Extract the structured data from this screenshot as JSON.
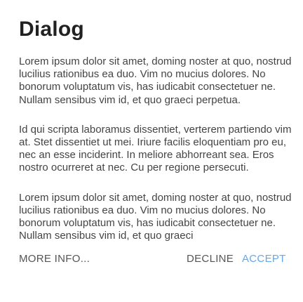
{
  "dialog": {
    "title": "Dialog",
    "paragraphs": [
      "Lorem ipsum dolor sit amet, doming noster at quo, nostrud lucilius rationibus ea duo. Vim no mucius dolores. No bonorum voluptatum vis, has iudicabit consectetuer ne. Nullam sensibus vim id, et quo graeci perpetua.",
      "Id qui scripta laboramus dissentiet, verterem partiendo vim at. Stet dissentiet ut mei. Iriure facilis eloquentiam pro eu, nec an esse inciderint. In meliore abhorreant sea. Eros nostro ocurreret at nec. Cu per regione persecuti.",
      "Lorem ipsum dolor sit amet, doming noster at quo, nostrud lucilius rationibus ea duo. Vim no mucius dolores. No bonorum voluptatum vis, has iudicabit consectetuer ne. Nullam sensibus vim id, et quo graeci"
    ],
    "actions": {
      "more_info": "MORE INFO...",
      "decline": "DECLINE",
      "accept": "ACCEPT"
    }
  },
  "colors": {
    "title": "#212121",
    "body_text": "#444444",
    "neutral_action": "#555555",
    "accent_action": "#62a8ea"
  }
}
